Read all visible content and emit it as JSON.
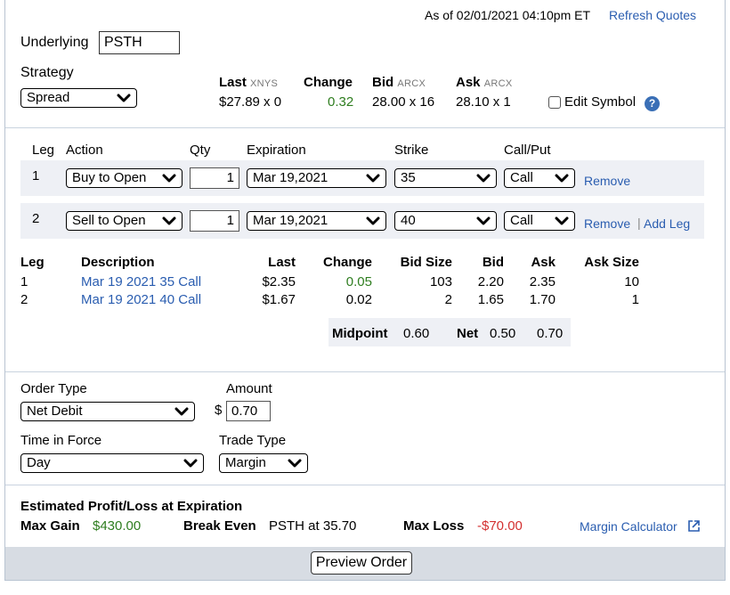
{
  "header": {
    "as_of": "As of 02/01/2021 04:10pm ET",
    "refresh_label": "Refresh Quotes"
  },
  "underlying": {
    "label": "Underlying",
    "value": "PSTH"
  },
  "strategy": {
    "label": "Strategy",
    "value": "Spread"
  },
  "quote": {
    "last_label": "Last",
    "last_exchange": "XNYS",
    "last_value": "$27.89 x 0",
    "change_label": "Change",
    "change_value": "0.32",
    "bid_label": "Bid",
    "bid_exchange": "ARCX",
    "bid_value": "28.00 x 16",
    "ask_label": "Ask",
    "ask_exchange": "ARCX",
    "ask_value": "28.10 x 1",
    "edit_symbol_label": "Edit Symbol",
    "edit_symbol_checked": false
  },
  "legs_header": {
    "leg": "Leg",
    "action": "Action",
    "qty": "Qty",
    "expiration": "Expiration",
    "strike": "Strike",
    "callput": "Call/Put"
  },
  "legs": [
    {
      "num": "1",
      "action": "Buy to Open",
      "qty": "1",
      "expiration": "Mar 19,2021",
      "strike": "35",
      "callput": "Call",
      "remove": "Remove"
    },
    {
      "num": "2",
      "action": "Sell to Open",
      "qty": "1",
      "expiration": "Mar 19,2021",
      "strike": "40",
      "callput": "Call",
      "remove": "Remove",
      "add_leg": "Add Leg"
    }
  ],
  "table": {
    "headers": {
      "leg": "Leg",
      "description": "Description",
      "last": "Last",
      "change": "Change",
      "bid_size": "Bid Size",
      "bid": "Bid",
      "ask": "Ask",
      "ask_size": "Ask Size"
    },
    "rows": [
      {
        "leg": "1",
        "description": "Mar 19 2021 35 Call",
        "last": "$2.35",
        "change": "0.05",
        "bid_size": "103",
        "bid": "2.20",
        "ask": "2.35",
        "ask_size": "10"
      },
      {
        "leg": "2",
        "description": "Mar 19 2021 40 Call",
        "last": "$1.67",
        "change": "0.02",
        "bid_size": "2",
        "bid": "1.65",
        "ask": "1.70",
        "ask_size": "1"
      }
    ],
    "midpoint_label": "Midpoint",
    "midpoint_value": "0.60",
    "net_label": "Net",
    "net_bid": "0.50",
    "net_ask": "0.70"
  },
  "order": {
    "order_type_label": "Order Type",
    "order_type_value": "Net Debit",
    "amount_label": "Amount",
    "currency": "$",
    "amount_value": "0.70",
    "tif_label": "Time in Force",
    "tif_value": "Day",
    "trade_type_label": "Trade Type",
    "trade_type_value": "Margin"
  },
  "estimate": {
    "title": "Estimated Profit/Loss at Expiration",
    "max_gain_label": "Max Gain",
    "max_gain_value": "$430.00",
    "break_even_label": "Break Even",
    "break_even_value": "PSTH at 35.70",
    "max_loss_label": "Max Loss",
    "max_loss_value": "-$70.00",
    "margin_calc_label": "Margin Calculator"
  },
  "footer": {
    "preview_label": "Preview Order"
  },
  "colors": {
    "link": "#2a5db0",
    "positive": "#2e7d1f",
    "negative": "#d32f2f",
    "row_bg": "#eef0f5",
    "footer_bg": "#d7dce3"
  },
  "icons": {
    "dropdown": "chevron-down-icon",
    "help": "question-circle-icon",
    "external": "external-link-icon"
  }
}
